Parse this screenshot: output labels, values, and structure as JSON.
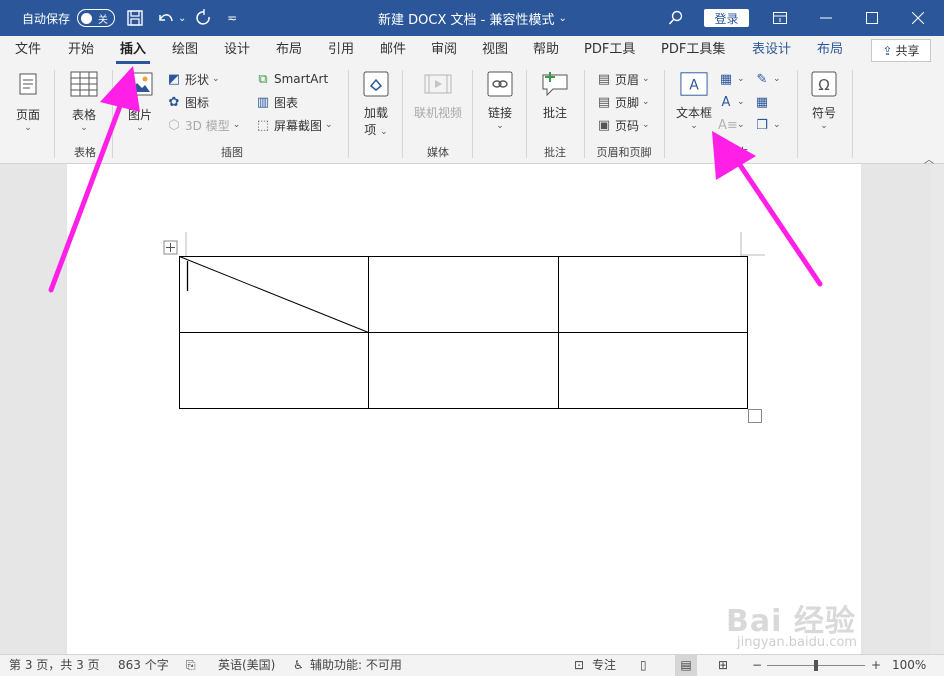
{
  "titlebar": {
    "autosave_label": "自动保存",
    "autosave_state": "关",
    "title": "新建 DOCX 文档  -  兼容性模式",
    "title_dropdown": "⌄",
    "signin": "登录",
    "save_icon": "save-icon",
    "undo_icon": "undo-icon",
    "redo_icon": "redo-icon",
    "customize_icon": "customize-icon"
  },
  "tabs": [
    {
      "label": "文件"
    },
    {
      "label": "开始"
    },
    {
      "label": "插入"
    },
    {
      "label": "绘图"
    },
    {
      "label": "设计"
    },
    {
      "label": "布局"
    },
    {
      "label": "引用"
    },
    {
      "label": "邮件"
    },
    {
      "label": "审阅"
    },
    {
      "label": "视图"
    },
    {
      "label": "帮助"
    },
    {
      "label": "PDF工具"
    },
    {
      "label": "PDF工具集"
    },
    {
      "label": "表设计"
    },
    {
      "label": "布局"
    }
  ],
  "share": {
    "label": "共享"
  },
  "ribbon": {
    "pages": {
      "label": "页面"
    },
    "table": {
      "label": "表格",
      "group": "表格"
    },
    "pictures": {
      "label": "图片"
    },
    "shapes": {
      "label": "形状"
    },
    "icons": {
      "label": "图标"
    },
    "model3d": {
      "label": "3D 模型"
    },
    "smartart": {
      "label": "SmartArt"
    },
    "chart": {
      "label": "图表"
    },
    "screenshot": {
      "label": "屏幕截图"
    },
    "illustrations_group": "插图",
    "addins": {
      "label_1": "加载",
      "label_2": "项"
    },
    "online_video": {
      "label": "联机视频"
    },
    "media_group": "媒体",
    "link": {
      "label": "链接"
    },
    "comment": {
      "label": "批注"
    },
    "comment_group": "批注",
    "header": {
      "label": "页眉"
    },
    "footer": {
      "label": "页脚"
    },
    "page_number": {
      "label": "页码"
    },
    "headerfooter_group": "页眉和页脚",
    "textbox": {
      "label": "文本框"
    },
    "text_group": "文本",
    "symbol": {
      "label": "符号"
    }
  },
  "status": {
    "page": "第 3 页，共 3 页",
    "words": "863 个字",
    "language": "英语(美国)",
    "accessibility": "辅助功能: 不可用",
    "focus": "专注",
    "zoom_minus": "−",
    "zoom_plus": "+",
    "zoom": "100%"
  },
  "watermark": {
    "main": "Bai 经验",
    "sub": "jingyan.baidu.com"
  },
  "colors": {
    "brand": "#2b579a",
    "arrow": "#ff1fe6"
  }
}
